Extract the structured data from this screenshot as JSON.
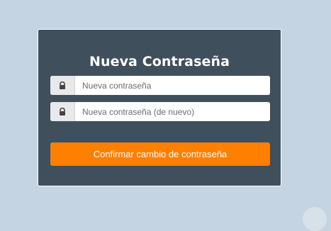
{
  "form": {
    "title": "Nueva Contraseña",
    "fields": [
      {
        "placeholder": "Nueva contraseña",
        "icon": "lock-icon"
      },
      {
        "placeholder": "Nueva contraseña (de nuevo)",
        "icon": "lock-icon"
      }
    ],
    "submit_label": "Confirmar cambio de contraseña"
  },
  "colors": {
    "page_background": "#c5d4e3",
    "card_background": "#3f4f5b",
    "button_background": "#ff7f00"
  }
}
